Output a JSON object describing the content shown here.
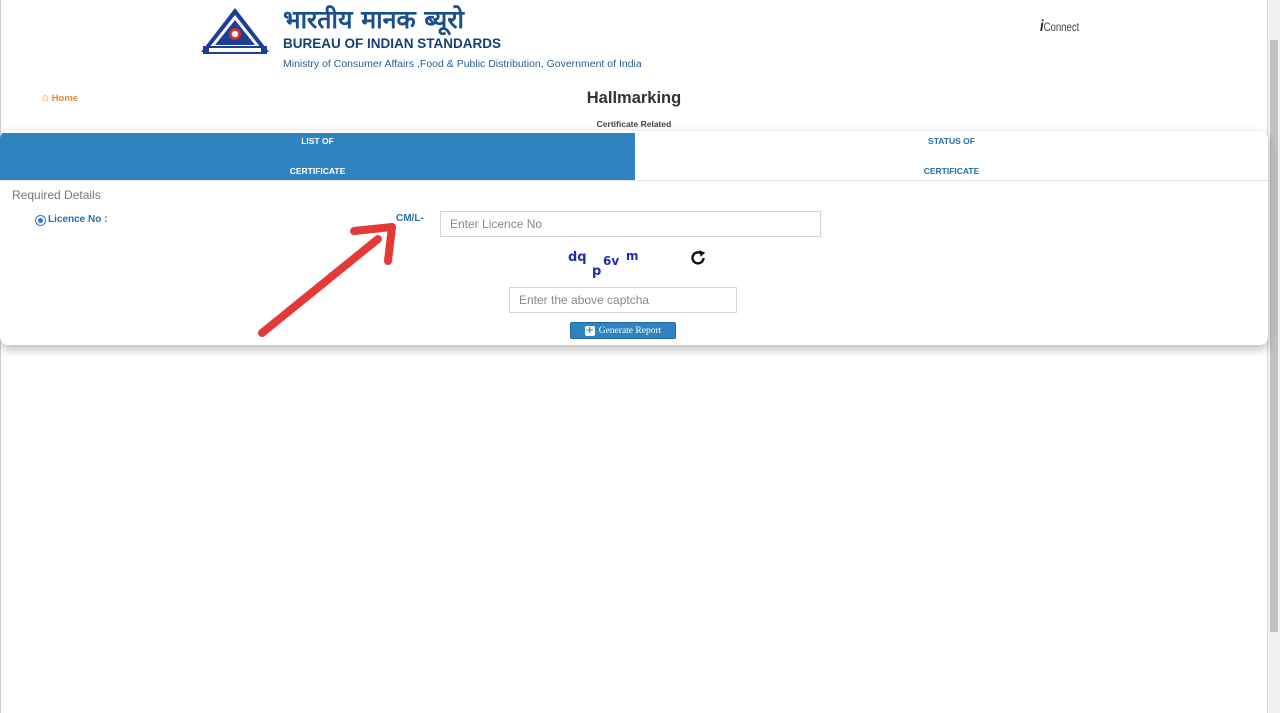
{
  "header": {
    "hindi_title": "भारतीय मानक ब्यूरो",
    "english_title": "BUREAU OF INDIAN STANDARDS",
    "ministry": "Ministry of Consumer Affairs ,Food & Public Distribution, Government of India",
    "logo_icon": "bis-logo",
    "brand_right": "Connect",
    "brand_right_prefix": "i"
  },
  "nav": {
    "home_label": "Home",
    "home_icon": "home-icon"
  },
  "page": {
    "title": "Hallmarking",
    "subtitle": "Certificate Related"
  },
  "tabs": [
    {
      "line1": "LIST OF",
      "line2": "CERTIFICATE",
      "active": true
    },
    {
      "line1": "STATUS OF",
      "line2": "CERTIFICATE",
      "active": false
    }
  ],
  "form": {
    "section_label": "Required Details",
    "radio_label": "Licence No :",
    "radio_selected": true,
    "prefix": "CM/L-",
    "licence_placeholder": "Enter Licence No",
    "licence_value": "",
    "captcha_text": "dq p6v m",
    "captcha_input_placeholder": "Enter the above captcha",
    "refresh_icon": "refresh-icon",
    "generate_label": "Generate Report",
    "generate_icon": "plus-square-icon"
  },
  "colors": {
    "primary_blue": "#2f84bf",
    "title_blue": "#1a4f8b",
    "home_orange": "#e6893a",
    "arrow_red": "#e53935"
  }
}
